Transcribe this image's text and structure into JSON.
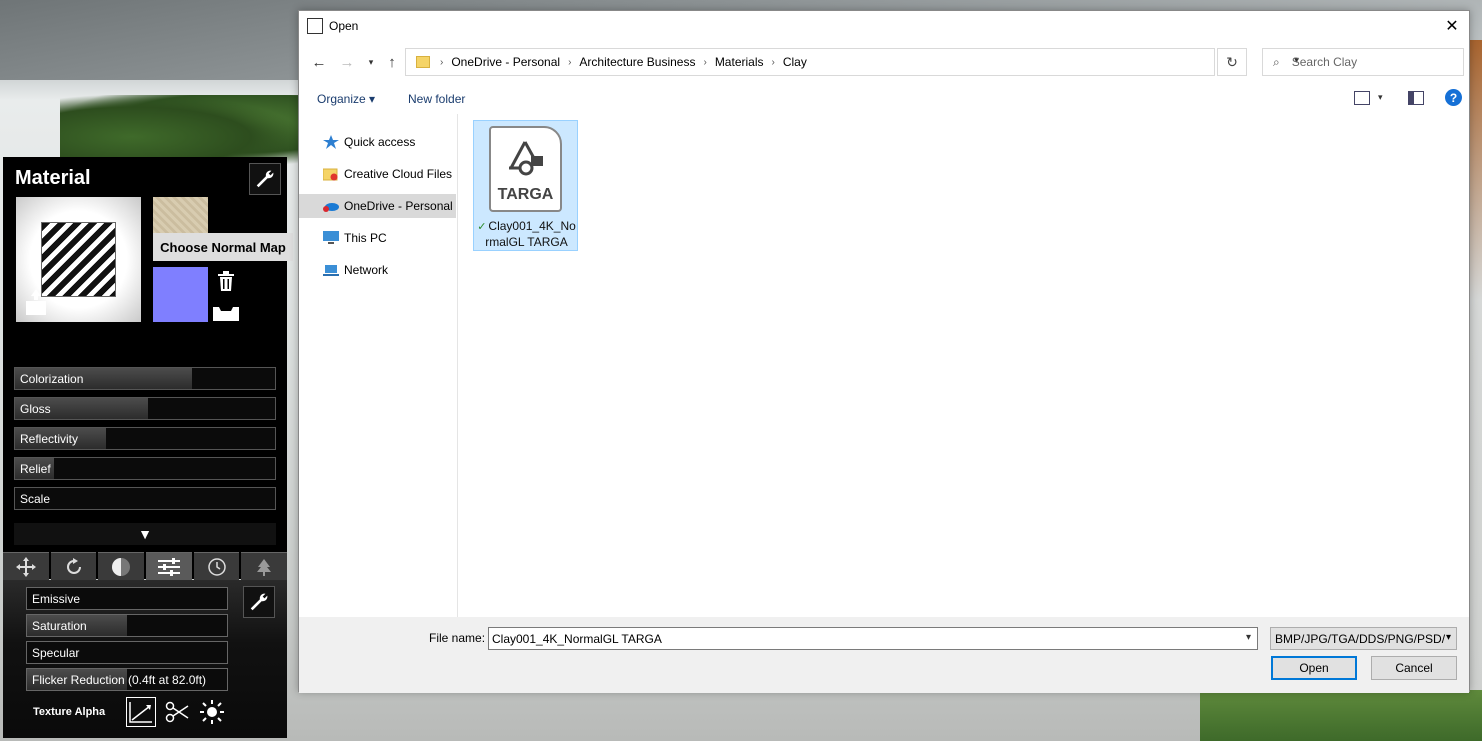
{
  "material_panel": {
    "title": "Material",
    "tooltip": "Choose Normal Map",
    "sliders": [
      {
        "label": "Colorization",
        "level": 0.68
      },
      {
        "label": "Gloss",
        "level": 0.51
      },
      {
        "label": "Reflectivity",
        "level": 0.35
      },
      {
        "label": "Relief",
        "level": 0.15
      },
      {
        "label": "Scale",
        "level": 0.0
      }
    ],
    "expand_glyph": "▼",
    "tabs": [
      "move-icon",
      "rotate-icon",
      "contrast-icon",
      "sliders-icon",
      "clock-icon",
      "tree-icon"
    ],
    "lower_sliders": [
      {
        "label": "Emissive",
        "level": 0.0,
        "value": ""
      },
      {
        "label": "Saturation",
        "level": 0.5,
        "value": ""
      },
      {
        "label": "Specular",
        "level": 0.0,
        "value": ""
      },
      {
        "label": "Flicker Reduction",
        "level": 0.5,
        "value": "(0.4ft at 82.0ft)"
      }
    ],
    "texture_alpha_label": "Texture Alpha"
  },
  "dialog": {
    "title": "Open",
    "breadcrumbs": [
      "OneDrive - Personal",
      "Architecture Business",
      "Materials",
      "Clay"
    ],
    "search_placeholder": "Search Clay",
    "toolbar": {
      "organize": "Organize ▾",
      "new_folder": "New folder",
      "help": "?"
    },
    "nav_items": [
      {
        "label": "Quick access"
      },
      {
        "label": "Creative Cloud Files"
      },
      {
        "label": "OneDrive - Personal"
      },
      {
        "label": "This PC"
      },
      {
        "label": "Network"
      }
    ],
    "file": {
      "icon_text": "TARGA",
      "name_line1": "Clay001_4K_No",
      "name_line2": "rmalGL TARGA"
    },
    "file_name_label": "File name:",
    "file_name_value": "Clay001_4K_NormalGL TARGA",
    "file_type": "BMP/JPG/TGA/DDS/PNG/PSD/",
    "open_label": "Open",
    "cancel_label": "Cancel"
  },
  "colors": {
    "accent": "#0078d7",
    "selection": "#cce8ff",
    "normal_map": "#7f7fff"
  }
}
